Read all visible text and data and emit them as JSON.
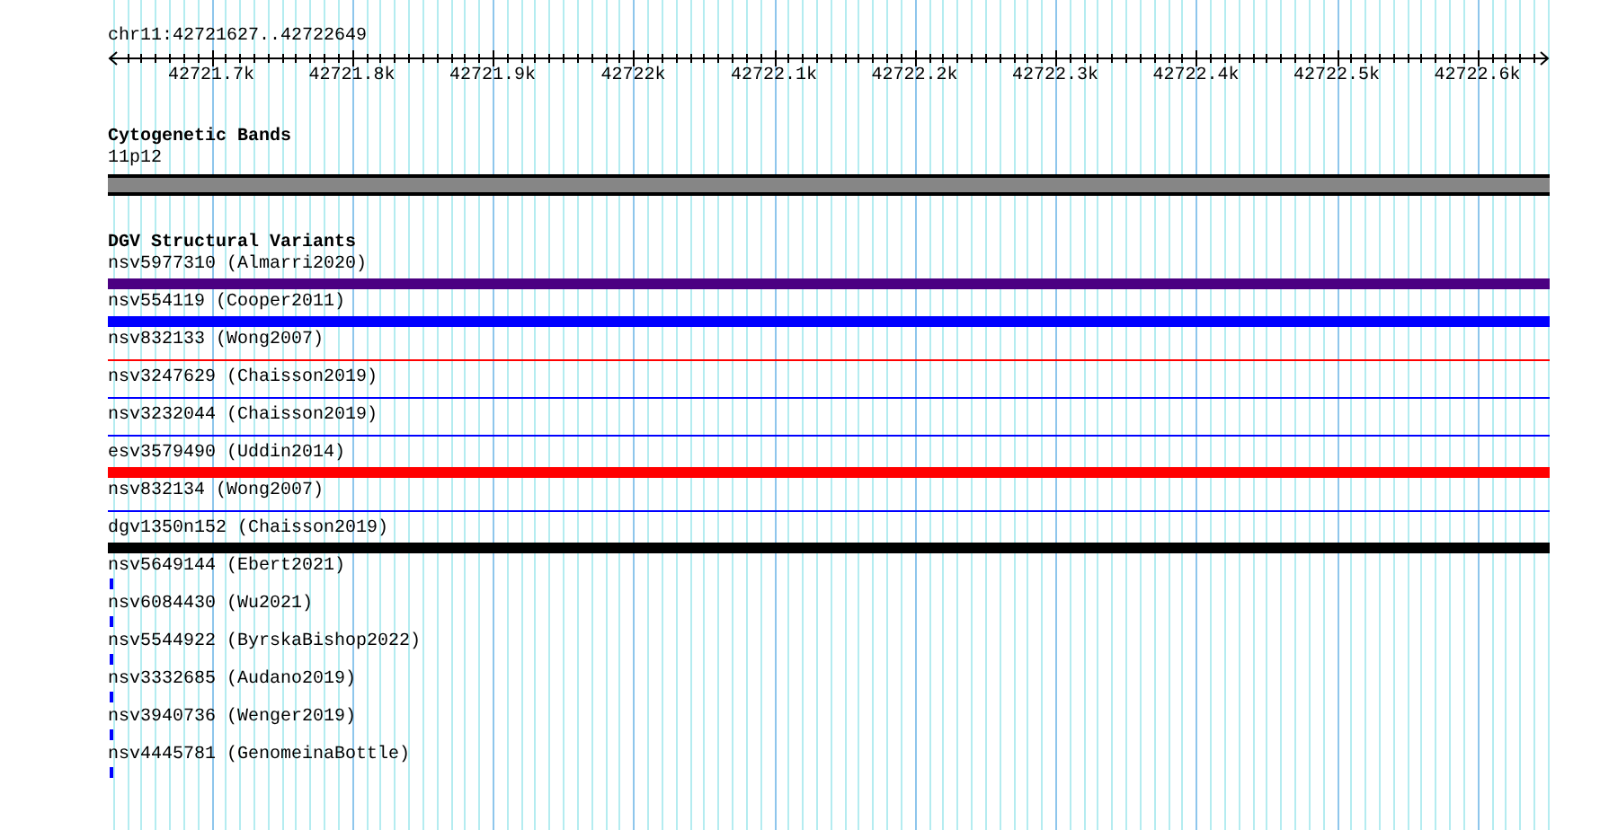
{
  "location": "chr11:42721627..42722649",
  "ruler": {
    "ticks": [
      "42721.7k",
      "42721.8k",
      "42721.9k",
      "42722k",
      "42722.1k",
      "42722.2k",
      "42722.3k",
      "42722.4k",
      "42722.5k",
      "42722.6k"
    ]
  },
  "tracks": [
    {
      "title": "Cytogenetic Bands",
      "kind": "bands",
      "features": [
        {
          "label": "11p12",
          "color": "#868686"
        }
      ]
    },
    {
      "title": "DGV Structural Variants",
      "kind": "variants",
      "features": [
        {
          "label": "nsv5977310 (Almarri2020)",
          "kind": "thick",
          "color": "#4b0082"
        },
        {
          "label": "nsv554119 (Cooper2011)",
          "kind": "thick",
          "color": "#0000ff"
        },
        {
          "label": "nsv832133 (Wong2007)",
          "kind": "thin",
          "color": "#ff0000"
        },
        {
          "label": "nsv3247629 (Chaisson2019)",
          "kind": "thin",
          "color": "#0000ff"
        },
        {
          "label": "nsv3232044 (Chaisson2019)",
          "kind": "thin",
          "color": "#0000ff"
        },
        {
          "label": "esv3579490 (Uddin2014)",
          "kind": "thick",
          "color": "#ff0000"
        },
        {
          "label": "nsv832134 (Wong2007)",
          "kind": "thin",
          "color": "#0000ff"
        },
        {
          "label": "dgv1350n152 (Chaisson2019)",
          "kind": "thick",
          "color": "#000000"
        },
        {
          "label": "nsv5649144 (Ebert2021)",
          "kind": "point",
          "color": "#0000ff"
        },
        {
          "label": "nsv6084430 (Wu2021)",
          "kind": "point",
          "color": "#0000ff"
        },
        {
          "label": "nsv5544922 (ByrskaBishop2022)",
          "kind": "point",
          "color": "#0000ff"
        },
        {
          "label": "nsv3332685 (Audano2019)",
          "kind": "point",
          "color": "#0000ff"
        },
        {
          "label": "nsv3940736 (Wenger2019)",
          "kind": "point",
          "color": "#0000ff"
        },
        {
          "label": "nsv4445781 (GenomeinaBottle)",
          "kind": "point",
          "color": "#0000ff"
        }
      ]
    }
  ]
}
